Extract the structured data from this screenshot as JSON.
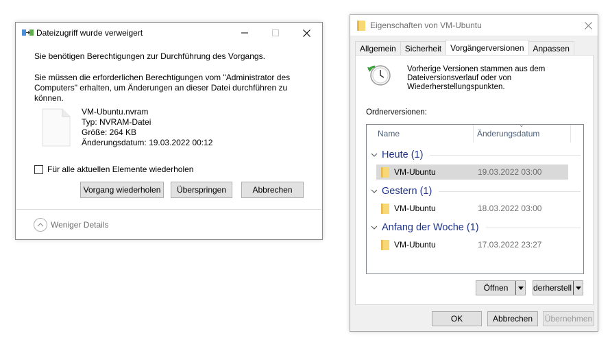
{
  "access_dialog": {
    "title": "Dateizugriff wurde verweigert",
    "icon": "file-transfer-icon",
    "message1": "Sie benötigen Berechtigungen zur Durchführung des Vorgangs.",
    "message2": "Sie müssen die erforderlichen Berechtigungen vom \"Administrator des Computers\" erhalten, um Änderungen an dieser Datei durchführen zu können.",
    "file": {
      "name": "VM-Ubuntu.nvram",
      "type": "Typ: NVRAM-Datei",
      "size": "Größe: 264 KB",
      "modified": "Änderungsdatum: 19.03.2022 00:12"
    },
    "repeat_checkbox_label": "Für alle aktuellen Elemente wiederholen",
    "repeat_checked": false,
    "buttons": {
      "retry": "Vorgang wiederholen",
      "skip": "Überspringen",
      "cancel": "Abbrechen"
    },
    "fewer_details": "Weniger Details"
  },
  "properties_dialog": {
    "title": "Eigenschaften von VM-Ubuntu",
    "tabs": [
      "Allgemein",
      "Sicherheit",
      "Vorgängerversionen",
      "Anpassen"
    ],
    "active_tab": "Vorgängerversionen",
    "info_text": "Vorherige Versionen stammen aus dem Dateiversionsverlauf oder von Wiederherstellungspunkten.",
    "folder_versions_label": "Ordnerversionen:",
    "columns": {
      "name": "Name",
      "date": "Änderungsdatum"
    },
    "groups": [
      {
        "label": "Heute (1)",
        "items": [
          {
            "name": "VM-Ubuntu",
            "date": "19.03.2022 03:00",
            "selected": true
          }
        ]
      },
      {
        "label": "Gestern (1)",
        "items": [
          {
            "name": "VM-Ubuntu",
            "date": "18.03.2022 03:00",
            "selected": false
          }
        ]
      },
      {
        "label": "Anfang der Woche (1)",
        "items": [
          {
            "name": "VM-Ubuntu",
            "date": "17.03.2022 23:27",
            "selected": false
          }
        ]
      }
    ],
    "open_button": "Öffnen",
    "restore_button": "ederherstell",
    "buttons": {
      "ok": "OK",
      "cancel": "Abbrechen",
      "apply": "Übernehmen"
    },
    "colors": {
      "group_header": "#1e3287",
      "folder": "#f8d775",
      "selection": "#d9d9d9"
    }
  }
}
